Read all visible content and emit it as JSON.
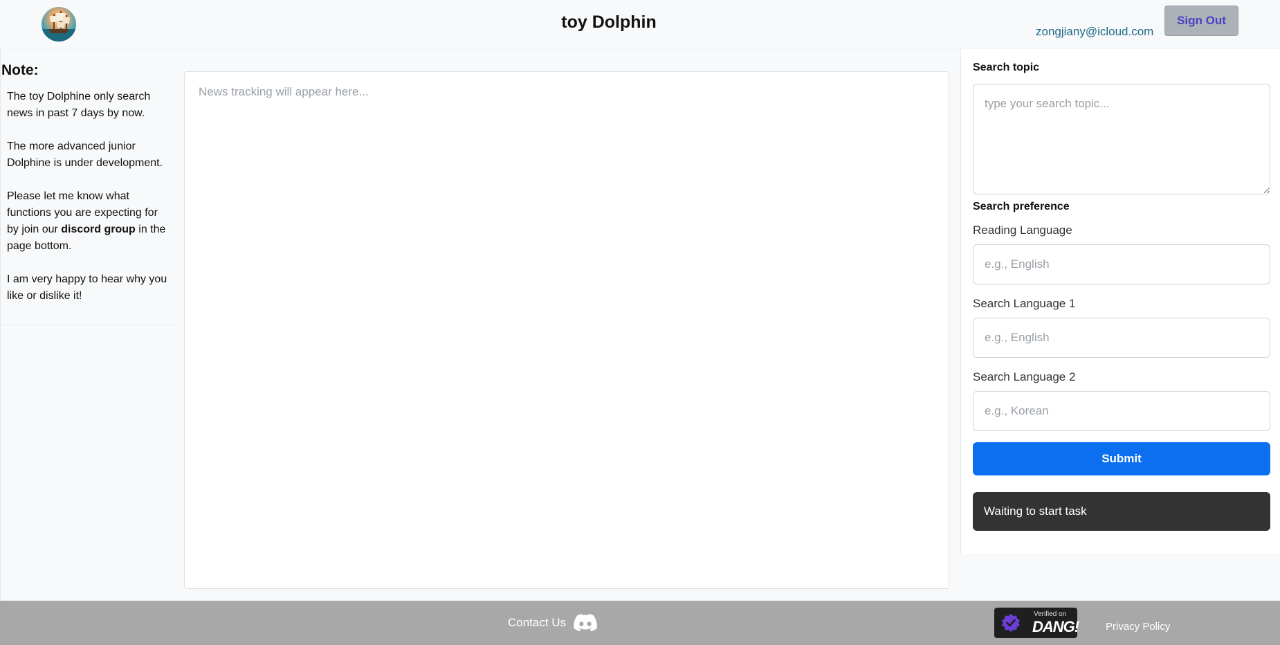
{
  "header": {
    "title": "toy Dolphin",
    "user_email": "zongjiany@icloud.com",
    "signout_label": "Sign Out",
    "logo_icon": "ship-logo-icon"
  },
  "sidebar": {
    "heading": "Note:",
    "paragraphs": [
      "The toy Dolphine only search news in past 7 days by now.",
      "The more advanced junior Dolphine is under development.",
      "I am very happy to hear why you like or dislike it!"
    ],
    "discord_para": {
      "before": "Please let me know what functions you are expecting for by join our ",
      "bold": "discord group",
      "after": " in the page bottom."
    }
  },
  "main": {
    "output_placeholder": "News tracking will appear here..."
  },
  "form": {
    "topic_label": "Search topic",
    "topic_placeholder": "type your search topic...",
    "preference_label": "Search preference",
    "reading_language_label": "Reading Language",
    "reading_language_placeholder": "e.g., English",
    "search_language1_label": "Search Language 1",
    "search_language1_placeholder": "e.g., English",
    "search_language2_label": "Search Language 2",
    "search_language2_placeholder": "e.g., Korean",
    "submit_label": "Submit",
    "status_text": "Waiting to start task"
  },
  "footer": {
    "contact_label": "Contact Us",
    "discord_icon": "discord-icon",
    "badge_verified": "Verified on",
    "badge_name": "DANG!",
    "privacy_label": "Privacy Policy"
  },
  "colors": {
    "submit": "#0b6ff0",
    "status_bg": "#333333",
    "footer_bg": "#a8a8a8",
    "signout_bg": "#adb1b8",
    "email": "#1f6b8a"
  }
}
